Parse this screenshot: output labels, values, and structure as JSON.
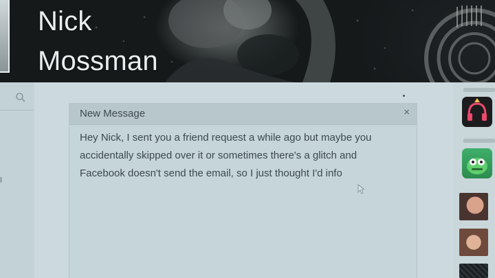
{
  "profile": {
    "first_name": "Nick",
    "last_name": "Mossman"
  },
  "message_window": {
    "title": "New Message",
    "close_symbol": "×",
    "body": "Hey Nick, I sent you a friend request a while ago but maybe you\naccidentally skipped over it or sometimes there's a glitch and\nFacebook doesn't send the email, so I just thought I'd info"
  },
  "icons": {
    "search": "search-icon",
    "close": "close-icon",
    "cursor": "text-cursor-icon",
    "music_app": "headphones-icon",
    "game_app": "green-monster-icon"
  },
  "colors": {
    "background": "#c7d6da",
    "message_header": "#b7c7cc",
    "message_text": "#3c494e",
    "name_text": "#e9eeef"
  }
}
